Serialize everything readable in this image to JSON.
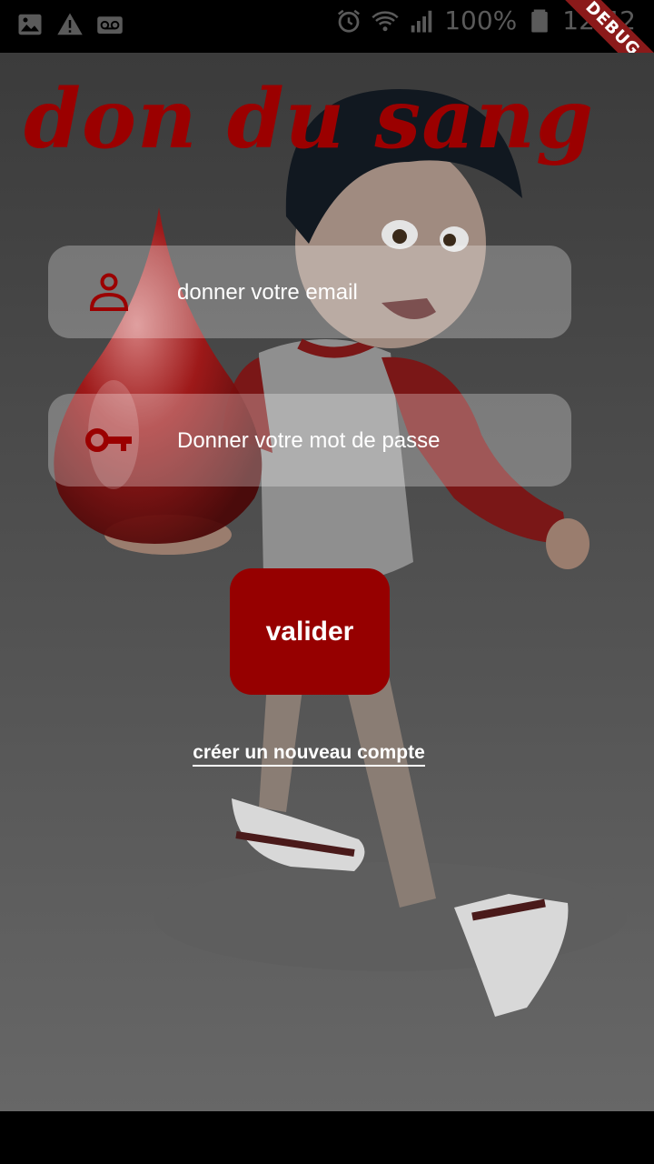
{
  "status_bar": {
    "battery": "100%",
    "time": "12:42",
    "icons": [
      "image-icon",
      "warning-icon",
      "voicemail-icon",
      "alarm-icon",
      "wifi-icon",
      "signal-icon",
      "battery-icon"
    ]
  },
  "debug_banner": "DEBUG",
  "app": {
    "title": "don du sang",
    "email_placeholder": "donner votre email",
    "password_placeholder": "Donner votre mot de passe",
    "submit_label": "valider",
    "create_account_link": "créer un nouveau compte"
  },
  "colors": {
    "brand_red": "#960000",
    "title_red": "#9b0000",
    "field_bg": "rgba(255,255,255,0.28)"
  }
}
